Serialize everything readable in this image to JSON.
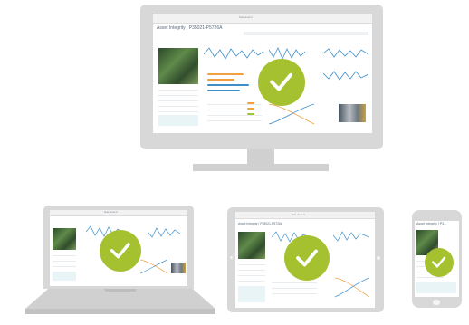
{
  "monitor": {
    "app_title": "Asset Integrity | P35021-P5726A",
    "url_text": "Suite.eb-tst.nl",
    "badge_color": "#a6c12f"
  },
  "laptop": {
    "app_title": "Asset Integrity",
    "url_text": "Suite.eb-tst.nl",
    "badge_color": "#a6c12f"
  },
  "tablet": {
    "app_title": "Asset Integrity | P35021-P5726A",
    "url_text": "Suite.eb-tst.nl",
    "badge_color": "#a6c12f"
  },
  "phone": {
    "app_title": "Asset Integrity | P3...",
    "badge_color": "#a6c12f"
  },
  "colors": {
    "shell": "#d8d8d8",
    "shell_dark": "#c4c4c4",
    "accent_blue": "#3d8fc9",
    "accent_orange": "#f0a040",
    "accent_green": "#a6c12f"
  }
}
